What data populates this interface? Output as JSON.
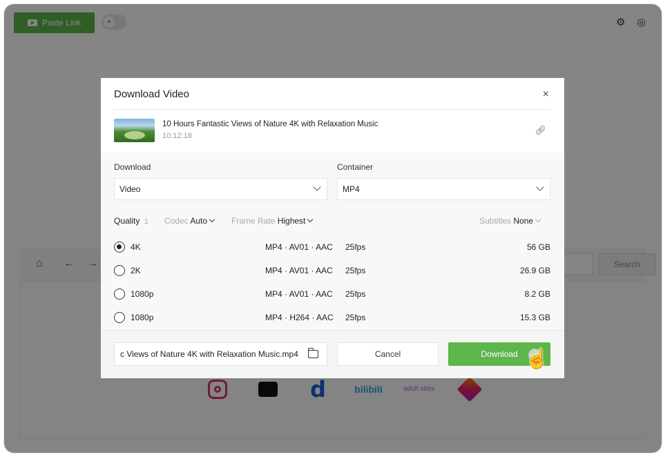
{
  "app": {
    "paste_link_label": "Paste Link",
    "settings_icon": "gear-icon",
    "account_icon": "user-circle-icon"
  },
  "browser": {
    "search_label": "Search"
  },
  "sites": {
    "bilibili_label": "bilibili",
    "adult_label": "adult sites"
  },
  "dialog": {
    "title": "Download Video",
    "close_glyph": "×",
    "video": {
      "title": "10 Hours Fantastic Views of Nature 4K with Relaxation Music",
      "duration": "10:12:18"
    },
    "download_label": "Download",
    "download_value": "Video",
    "container_label": "Container",
    "container_value": "MP4",
    "quality_label": "Quality",
    "quality_count": "1",
    "codec_label": "Codec",
    "codec_value": "Auto",
    "frame_rate_label": "Frame Rate",
    "frame_rate_value": "Highest",
    "subtitles_label": "Subtitles",
    "subtitles_value": "None",
    "formats": [
      {
        "resolution": "4K",
        "codec": "MP4 · AV01 · AAC",
        "fps": "25fps",
        "size": "56 GB",
        "selected": true
      },
      {
        "resolution": "2K",
        "codec": "MP4 · AV01 · AAC",
        "fps": "25fps",
        "size": "26.9 GB",
        "selected": false
      },
      {
        "resolution": "1080p",
        "codec": "MP4 · AV01 · AAC",
        "fps": "25fps",
        "size": "8.2 GB",
        "selected": false
      },
      {
        "resolution": "1080p",
        "codec": "MP4 · H264 · AAC",
        "fps": "25fps",
        "size": "15.3 GB",
        "selected": false
      }
    ],
    "filename": "c Views of Nature 4K with Relaxation Music.mp4",
    "cancel_label": "Cancel",
    "download_button_label": "Download"
  },
  "colors": {
    "accent": "#5db54b"
  }
}
